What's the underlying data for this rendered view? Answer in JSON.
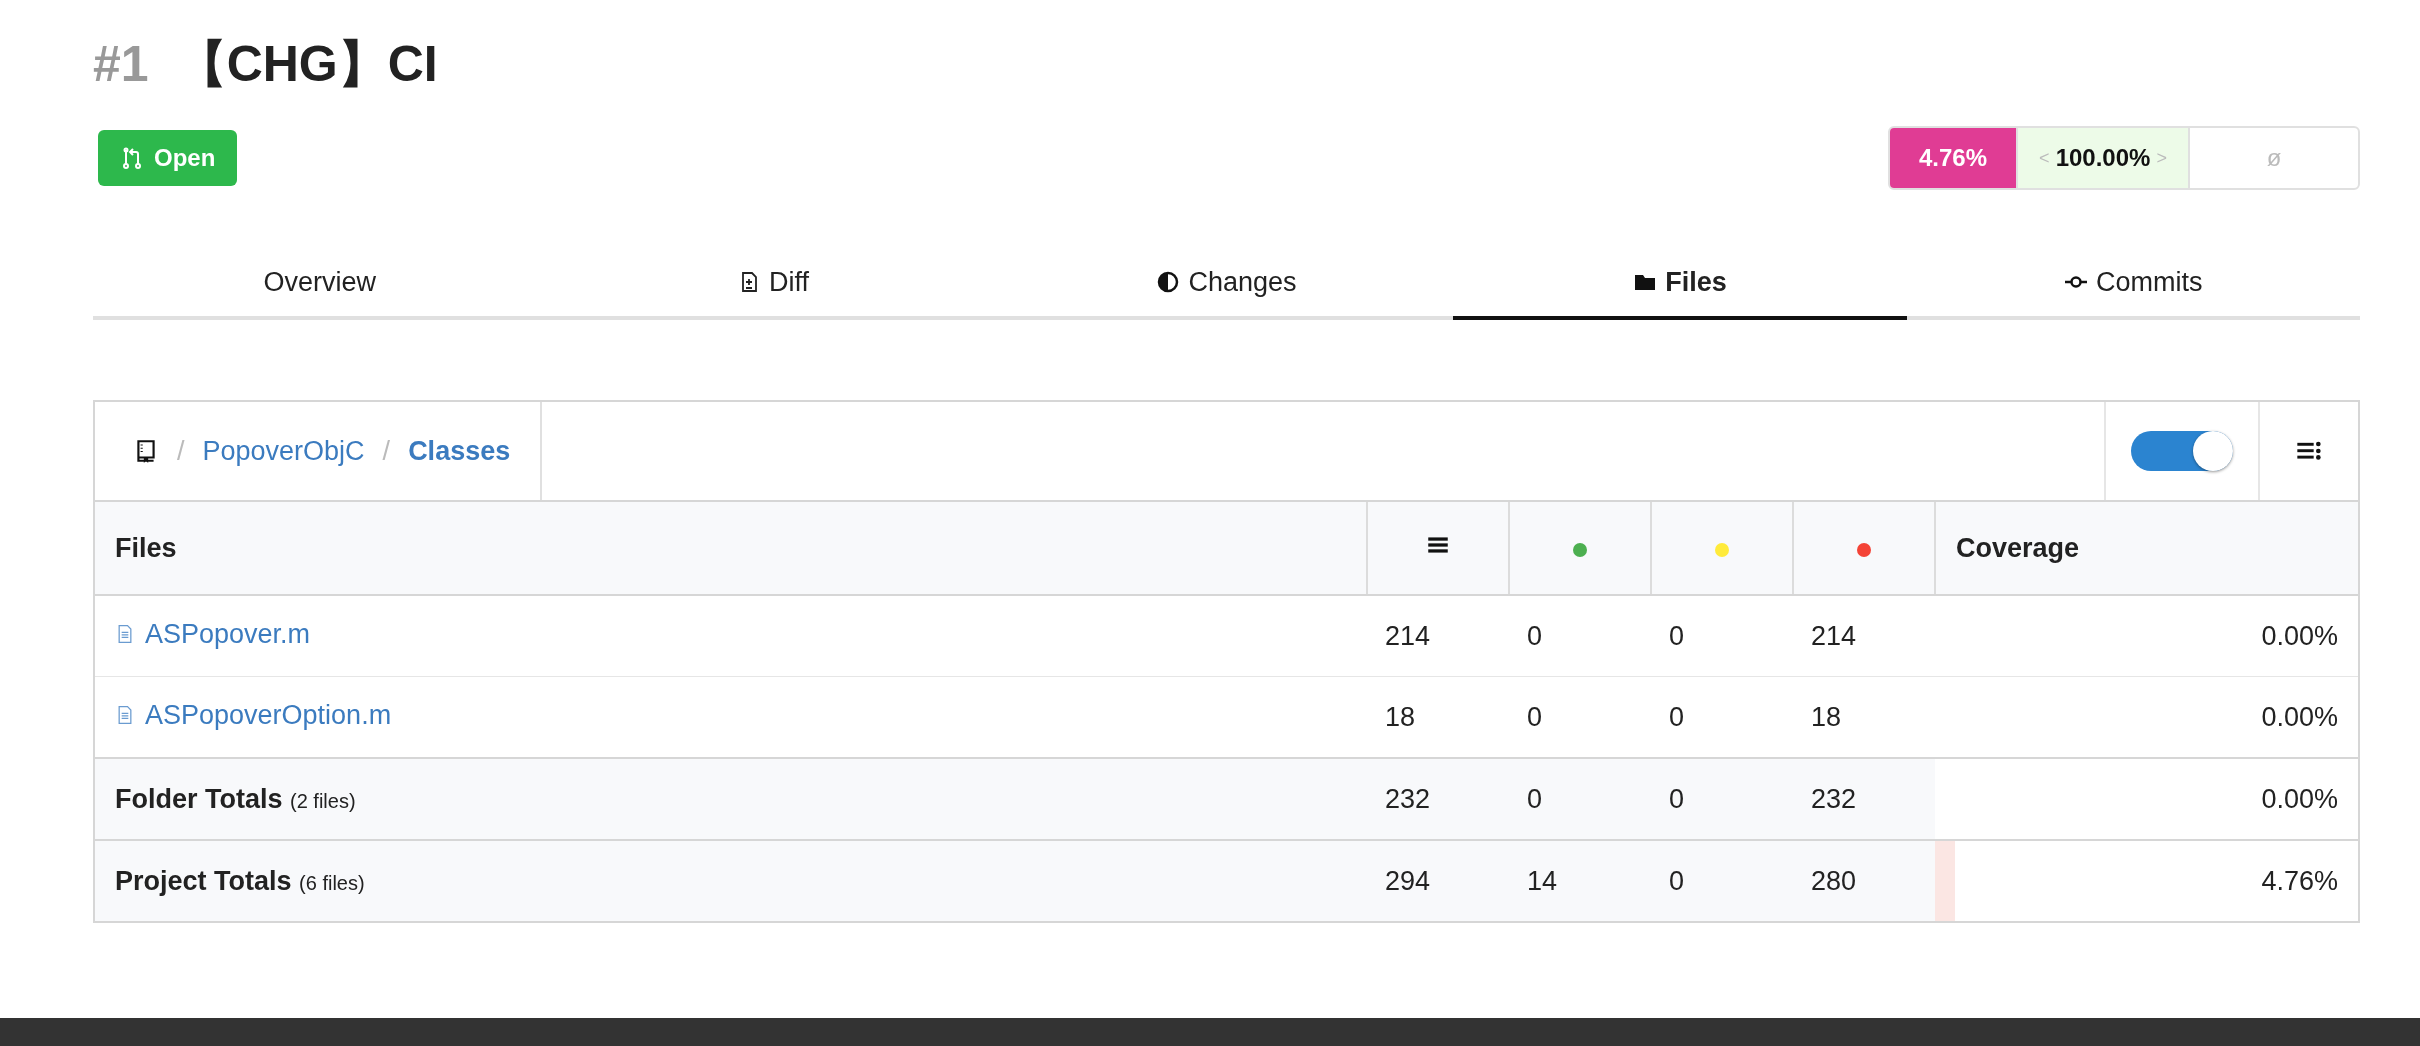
{
  "header": {
    "number": "#1",
    "title": "【CHG】CI",
    "status": "Open"
  },
  "coverage_pill": {
    "value": "4.76%",
    "prev_arrow": "<",
    "compare": "100.00%",
    "next_arrow": ">",
    "diff": "ø"
  },
  "tabs": [
    {
      "label": "Overview",
      "selected": false
    },
    {
      "label": "Diff",
      "selected": false
    },
    {
      "label": "Changes",
      "selected": false
    },
    {
      "label": "Files",
      "selected": true
    },
    {
      "label": "Commits",
      "selected": false
    }
  ],
  "breadcrumb": [
    {
      "separator": "/",
      "label": "PopoverObjC",
      "current": false
    },
    {
      "separator": "/",
      "label": "Classes",
      "current": true
    }
  ],
  "toggle": {
    "on": true
  },
  "table": {
    "columns": [
      {
        "kind": "text",
        "label": "Files"
      },
      {
        "kind": "lines"
      },
      {
        "kind": "dot",
        "color": "#4caf50"
      },
      {
        "kind": "dot",
        "color": "#ffeb3b"
      },
      {
        "kind": "dot",
        "color": "#f44336"
      },
      {
        "kind": "text",
        "label": "Coverage"
      }
    ],
    "rows": [
      {
        "kind": "file",
        "name": "ASPopover.m",
        "lines": "214",
        "hits": "0",
        "partials": "0",
        "misses": "214",
        "coverage": "0.00%"
      },
      {
        "kind": "file",
        "name": "ASPopoverOption.m",
        "lines": "18",
        "hits": "0",
        "partials": "0",
        "misses": "18",
        "coverage": "0.00%"
      },
      {
        "kind": "total",
        "name": "Folder Totals",
        "note": "(2 files)",
        "lines": "232",
        "hits": "0",
        "partials": "0",
        "misses": "232",
        "coverage": "0.00%"
      },
      {
        "kind": "total",
        "name": "Project Totals",
        "note": "(6 files)",
        "lines": "294",
        "hits": "14",
        "partials": "0",
        "misses": "280",
        "coverage": "4.76%",
        "level": 0.0476
      }
    ]
  }
}
